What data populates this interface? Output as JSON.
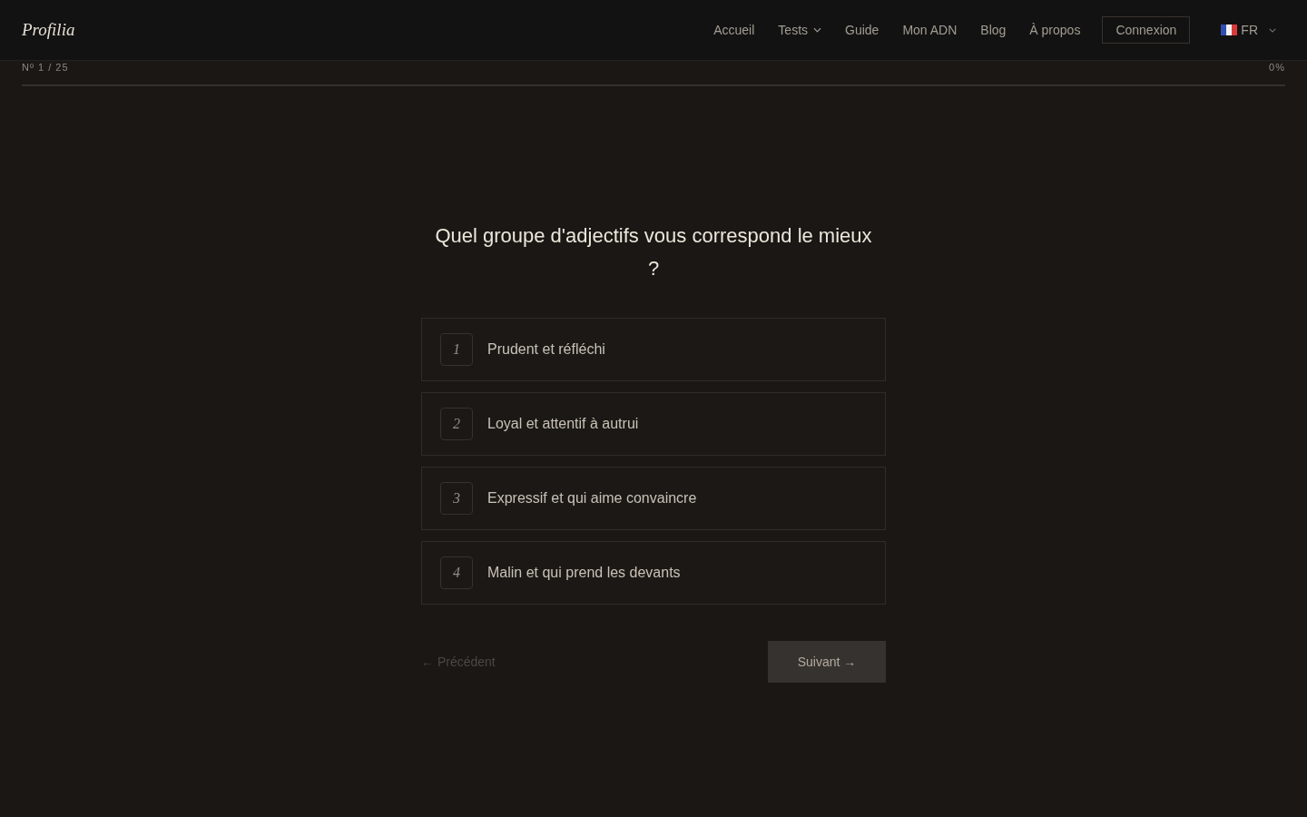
{
  "header": {
    "logo": "Profilia",
    "nav": [
      {
        "label": "Accueil",
        "kind": "link"
      },
      {
        "label": "Tests",
        "kind": "dropdown"
      },
      {
        "label": "Guide",
        "kind": "link"
      },
      {
        "label": "Mon ADN",
        "kind": "link"
      },
      {
        "label": "Blog",
        "kind": "link"
      },
      {
        "label": "À propos",
        "kind": "link"
      }
    ],
    "login_button": "Connexion",
    "language": "FR"
  },
  "progress": {
    "counter": "Nº 1 / 25",
    "percent": "0%",
    "level": 0
  },
  "question": {
    "text": "Quel groupe d'adjectifs vous correspond le mieux ?",
    "options": [
      {
        "number": "1",
        "label": "Prudent et réfléchi",
        "selected": false
      },
      {
        "number": "2",
        "label": "Loyal et attentif à autrui",
        "selected": false
      },
      {
        "number": "3",
        "label": "Expressif et qui aime convaincre",
        "selected": false
      },
      {
        "number": "4",
        "label": "Malin et qui prend les devants",
        "selected": false
      }
    ]
  },
  "navigation": {
    "previous": {
      "label": "← Précédent",
      "disabled": true
    },
    "next": {
      "label": "Suivant →",
      "disabled": true
    }
  }
}
